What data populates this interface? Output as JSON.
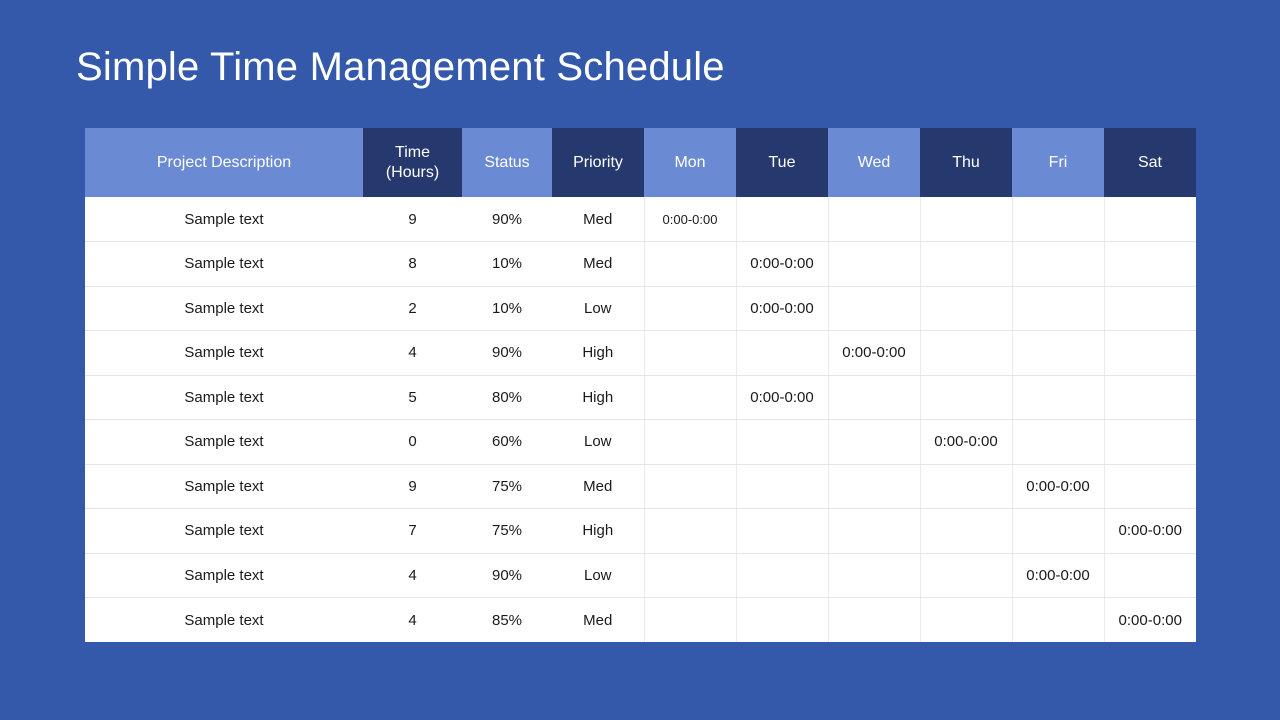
{
  "slide": {
    "title": "Simple Time Management Schedule",
    "background_color": "#3459ab"
  },
  "palette": {
    "light_blue": "#6b8ad4",
    "mid_blue": "#3a5bb5",
    "dark_navy": "#25396e",
    "white": "#ffffff",
    "row_divider": "#e4e6ee"
  },
  "table": {
    "headers": [
      {
        "label": "Project Description",
        "shade": "light"
      },
      {
        "label": "Time\n(Hours)",
        "line1": "Time",
        "line2": "(Hours)",
        "shade": "dark"
      },
      {
        "label": "Status",
        "shade": "light"
      },
      {
        "label": "Priority",
        "shade": "dark"
      },
      {
        "label": "Mon",
        "shade": "light"
      },
      {
        "label": "Tue",
        "shade": "dark"
      },
      {
        "label": "Wed",
        "shade": "light"
      },
      {
        "label": "Thu",
        "shade": "dark"
      },
      {
        "label": "Fri",
        "shade": "light"
      },
      {
        "label": "Sat",
        "shade": "dark"
      }
    ],
    "day_labels": [
      "Mon",
      "Tue",
      "Wed",
      "Thu",
      "Fri",
      "Sat"
    ],
    "rows": [
      {
        "description": "Sample text",
        "hours": "9",
        "status": "90%",
        "status_shade": "light",
        "priority": "Med",
        "priority_shade": "mid",
        "days": [
          "0:00-0:00",
          "",
          "",
          "",
          "",
          ""
        ],
        "day_text_small": true
      },
      {
        "description": "Sample text",
        "hours": "8",
        "status": "10%",
        "status_shade": "dark",
        "priority": "Med",
        "priority_shade": "mid",
        "days": [
          "",
          "0:00-0:00",
          "",
          "",
          "",
          ""
        ],
        "day_text_small": false
      },
      {
        "description": "Sample text",
        "hours": "2",
        "status": "10%",
        "status_shade": "dark",
        "priority": "Low",
        "priority_shade": "light",
        "days": [
          "",
          "0:00-0:00",
          "",
          "",
          "",
          ""
        ],
        "day_text_small": false
      },
      {
        "description": "Sample text",
        "hours": "4",
        "status": "90%",
        "status_shade": "light",
        "priority": "High",
        "priority_shade": "dark",
        "days": [
          "",
          "",
          "0:00-0:00",
          "",
          "",
          ""
        ],
        "day_text_small": false
      },
      {
        "description": "Sample text",
        "hours": "5",
        "status": "80%",
        "status_shade": "light",
        "priority": "High",
        "priority_shade": "dark",
        "days": [
          "",
          "0:00-0:00",
          "",
          "",
          "",
          ""
        ],
        "day_text_small": false
      },
      {
        "description": "Sample text",
        "hours": "0",
        "status": "60%",
        "status_shade": "mid",
        "priority": "Low",
        "priority_shade": "light",
        "days": [
          "",
          "",
          "",
          "0:00-0:00",
          "",
          ""
        ],
        "day_text_small": false
      },
      {
        "description": "Sample text",
        "hours": "9",
        "status": "75%",
        "status_shade": "mid",
        "priority": "Med",
        "priority_shade": "light",
        "days": [
          "",
          "",
          "",
          "",
          "0:00-0:00",
          ""
        ],
        "day_text_small": false
      },
      {
        "description": "Sample text",
        "hours": "7",
        "status": "75%",
        "status_shade": "mid",
        "priority": "High",
        "priority_shade": "dark",
        "days": [
          "",
          "",
          "",
          "",
          "",
          "0:00-0:00"
        ],
        "day_text_small": false
      },
      {
        "description": "Sample text",
        "hours": "4",
        "status": "90%",
        "status_shade": "light",
        "priority": "Low",
        "priority_shade": "light",
        "days": [
          "",
          "",
          "",
          "",
          "0:00-0:00",
          ""
        ],
        "day_text_small": false
      },
      {
        "description": "Sample text",
        "hours": "4",
        "status": "85%",
        "status_shade": "light",
        "priority": "Med",
        "priority_shade": "mid",
        "days": [
          "",
          "",
          "",
          "",
          "",
          "0:00-0:00"
        ],
        "day_text_small": false
      }
    ]
  }
}
